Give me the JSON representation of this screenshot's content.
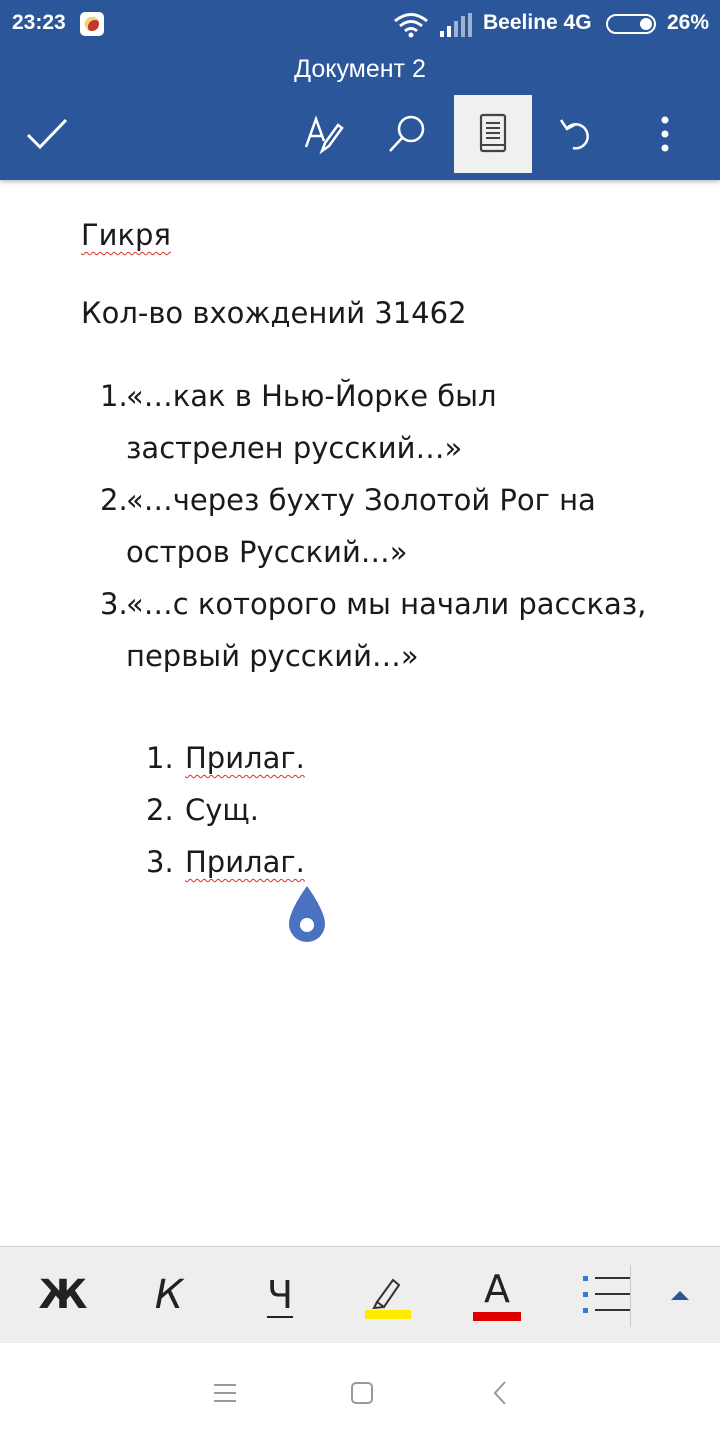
{
  "status_bar": {
    "time": "23:23",
    "carrier": "Beeline 4G",
    "battery_percent": "26%",
    "battery_level": 0.26,
    "icons": [
      "app-notification-icon",
      "wifi-icon",
      "signal-icon",
      "battery-icon"
    ]
  },
  "app_bar": {
    "title": "Документ 2",
    "background_color": "#2b579a",
    "buttons": [
      {
        "name": "done",
        "icon": "checkmark-icon"
      },
      {
        "name": "edit",
        "icon": "pen-edit-icon"
      },
      {
        "name": "find",
        "icon": "search-icon"
      },
      {
        "name": "view",
        "icon": "reading-view-icon",
        "active": true
      },
      {
        "name": "undo",
        "icon": "undo-icon"
      },
      {
        "name": "more",
        "icon": "more-vertical-icon"
      }
    ]
  },
  "document": {
    "heading": "Гикря",
    "count_line": "Кол-во вхождений 31462",
    "list_a": [
      {
        "num": "1.",
        "text": "«…как в Нью-Йорке был застрелен русский…»"
      },
      {
        "num": "2.",
        "text": "«…через бухту Золотой Рог на остров Русский…»"
      },
      {
        "num": "3.",
        "text": " «…с которого мы начали рассказ, первый русский…»"
      }
    ],
    "list_b": [
      {
        "num": "1.",
        "text": "Прилаг."
      },
      {
        "num": "2.",
        "text": "Сущ."
      },
      {
        "num": "3.",
        "text": "Прилаг."
      }
    ]
  },
  "format_toolbar": {
    "bold_label": "Ж",
    "italic_label": "К",
    "underline_label": "Ч",
    "font_color_letter": "A",
    "highlight_color": "#ffeb00",
    "font_color": "#e00000",
    "icons": [
      "highlighter-icon",
      "bullet-list-icon",
      "expand-up-icon"
    ]
  },
  "nav_bar": {
    "icons": [
      "menu-icon",
      "home-icon",
      "back-icon"
    ]
  }
}
